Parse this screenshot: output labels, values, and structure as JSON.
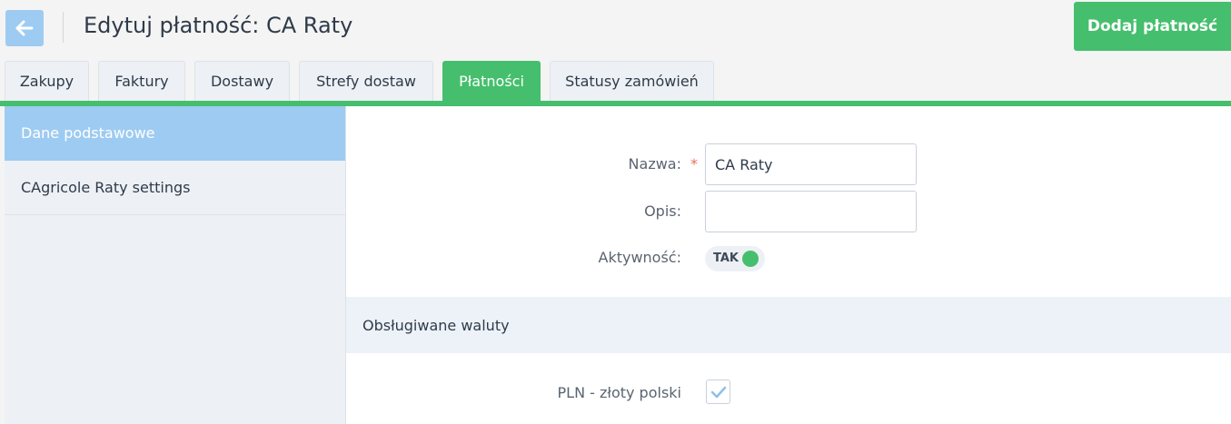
{
  "header": {
    "title": "Edytuj płatność: CA Raty",
    "add_button": "Dodaj płatność",
    "back_icon": "arrow-left-icon"
  },
  "tabs": [
    {
      "label": "Zakupy",
      "active": false
    },
    {
      "label": "Faktury",
      "active": false
    },
    {
      "label": "Dostawy",
      "active": false
    },
    {
      "label": "Strefy dostaw",
      "active": false
    },
    {
      "label": "Płatności",
      "active": true
    },
    {
      "label": "Statusy zamówień",
      "active": false
    }
  ],
  "sidebar": {
    "items": [
      {
        "label": "Dane podstawowe",
        "active": true
      },
      {
        "label": "CAgricole Raty settings",
        "active": false
      }
    ]
  },
  "form": {
    "name_label": "Nazwa:",
    "required_mark": "*",
    "name_value": "CA Raty",
    "description_label": "Opis:",
    "description_value": "",
    "active_label": "Aktywność:",
    "active_toggle_text": "TAK",
    "active_on": true
  },
  "currencies": {
    "section_title": "Obsługiwane waluty",
    "items": [
      {
        "label": "PLN - złoty polski",
        "checked": true
      }
    ]
  },
  "colors": {
    "accent_green": "#45bf6d",
    "accent_blue": "#9ecbf1",
    "required_red": "#e8705c"
  }
}
